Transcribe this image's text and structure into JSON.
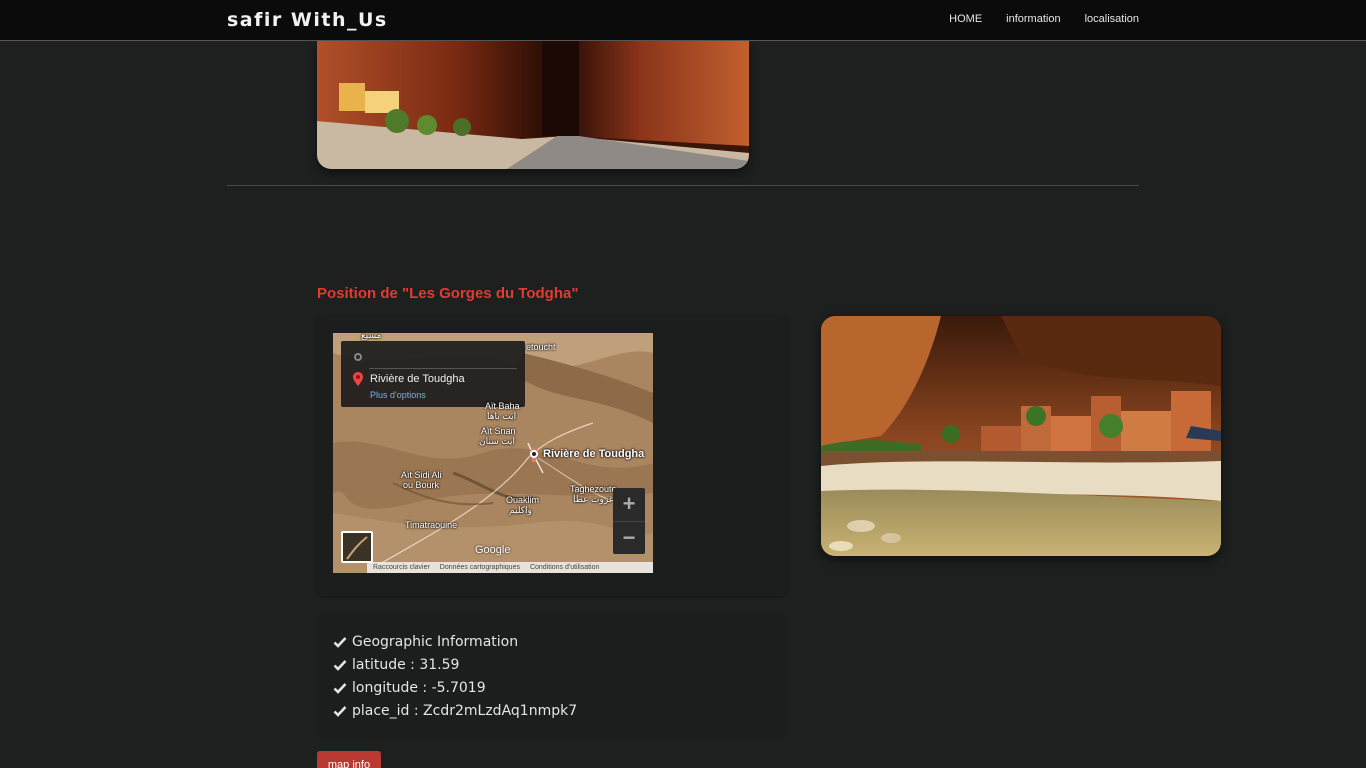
{
  "navbar": {
    "brand": "safir With_Us",
    "links": [
      "HOME",
      "information",
      "localisation"
    ]
  },
  "section": {
    "title": "Position de \"Les Gorges du Todgha\""
  },
  "map": {
    "popup_destination": "Rivière de Toudgha",
    "popup_more": "Plus d'options",
    "labels": {
      "riviere": "Rivière de Toudgha",
      "ait_snan": "Aït Snan",
      "ait_snan_ar": "ايت سنان",
      "ait_baha": "Aït Baha",
      "ait_baha_ar": "ايت باها",
      "ait_sidi_ali": "Aït Sidi Ali",
      "ou_bourk": "ou Bourk",
      "ouaklim": "Ouaklim",
      "ouaklim_ar": "واكليم",
      "taghezoute": "Taghezoute",
      "taghezoute_ar": "تاغزوت عطا",
      "timatraouine": "Timatraouine",
      "tetoucht": "etoucht",
      "top_ar": "مسيع"
    },
    "google": "Google",
    "footer": [
      "Raccourcis clavier",
      "Données cartographiques",
      "Conditions d'utilisation"
    ],
    "zoom_in": "+",
    "zoom_out": "−"
  },
  "info": {
    "items": [
      "Geographic Information",
      "latitude : 31.59",
      "longitude : -5.7019",
      "place_id : Zcdr2mLzdAq1nmpk7"
    ]
  },
  "buttons": {
    "map_info": "map info"
  },
  "colors": {
    "accent": "#e33a32",
    "button": "#b83a32",
    "background": "#1e1f1f",
    "navbar": "#0b0b0b"
  }
}
